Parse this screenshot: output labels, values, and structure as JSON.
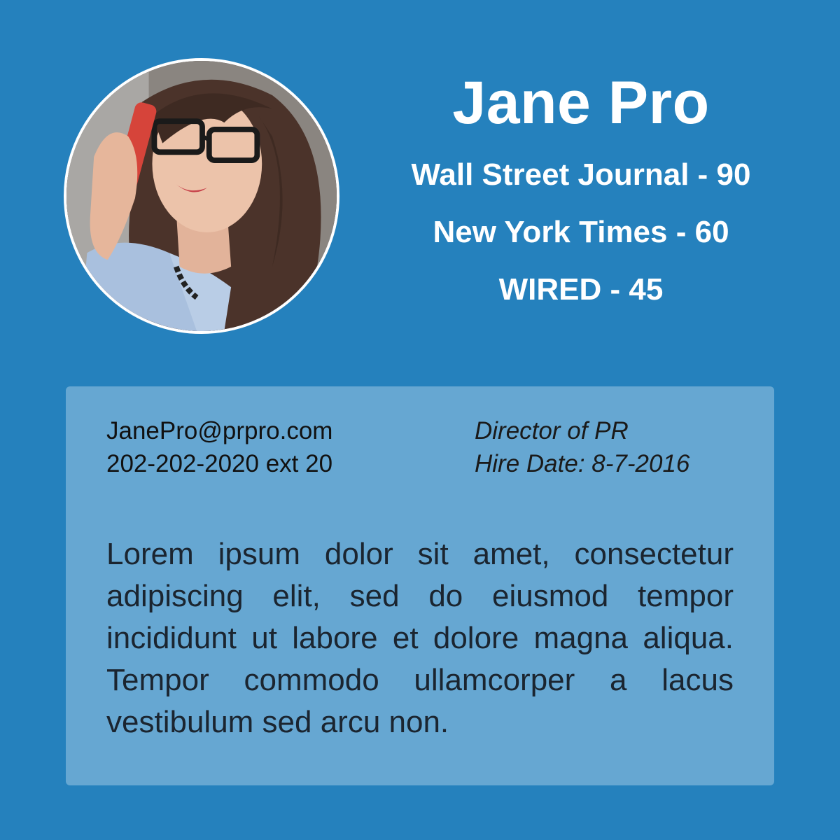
{
  "profile": {
    "name": "Jane Pro",
    "photo_alt": "woman-on-phone-photo",
    "outlets": [
      {
        "label": "Wall Street Journal - 90"
      },
      {
        "label": "New York Times - 60"
      },
      {
        "label": "WIRED - 45"
      }
    ]
  },
  "card": {
    "email": "JanePro@prpro.com",
    "phone": "202-202-2020 ext 20",
    "title": "Director of PR",
    "hire_date": "Hire Date: 8-7-2016",
    "bio": "Lorem ipsum dolor sit amet, consectetur adipiscing elit, sed do eiusmod tempor incididunt ut labore et dolore magna aliqua. Tempor commodo ullamcorper a lacus vestibulum sed arcu non."
  },
  "colors": {
    "background": "#2581bd",
    "card": "#66a7d2",
    "text_light": "#ffffff",
    "text_dark": "#1b2530"
  }
}
